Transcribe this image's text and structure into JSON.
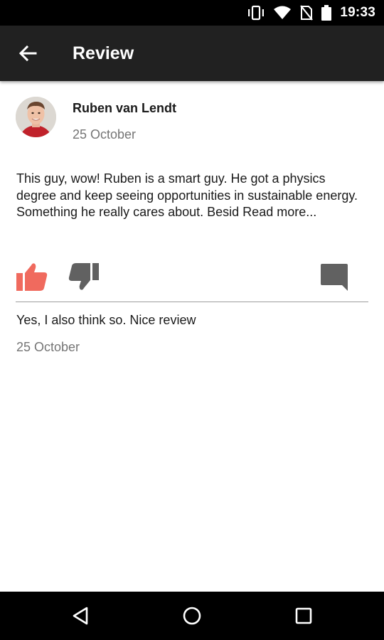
{
  "status_bar": {
    "time": "19:33",
    "icons": [
      "vibrate-icon",
      "wifi-icon",
      "no-sim-icon",
      "battery-icon"
    ]
  },
  "app_bar": {
    "title": "Review",
    "back_icon": "arrow-back-icon"
  },
  "review": {
    "author_name": "Ruben van Lendt",
    "date": "25 October",
    "text": "This guy, wow! Ruben is a smart guy. He got a physics degree and keep seeing opportunities in sustainable energy. Something he really cares about. Besid Read more..."
  },
  "actions": {
    "like_icon": "thumbs-up-icon",
    "dislike_icon": "thumbs-down-icon",
    "comment_icon": "comment-icon",
    "like_color": "#f06a5e",
    "neutral_color": "#616161"
  },
  "comments": [
    {
      "text": "Yes, I also think so. Nice review",
      "date": "25 October"
    }
  ],
  "nav_bar": {
    "back_icon": "nav-back-icon",
    "home_icon": "nav-home-icon",
    "recents_icon": "nav-recents-icon"
  }
}
